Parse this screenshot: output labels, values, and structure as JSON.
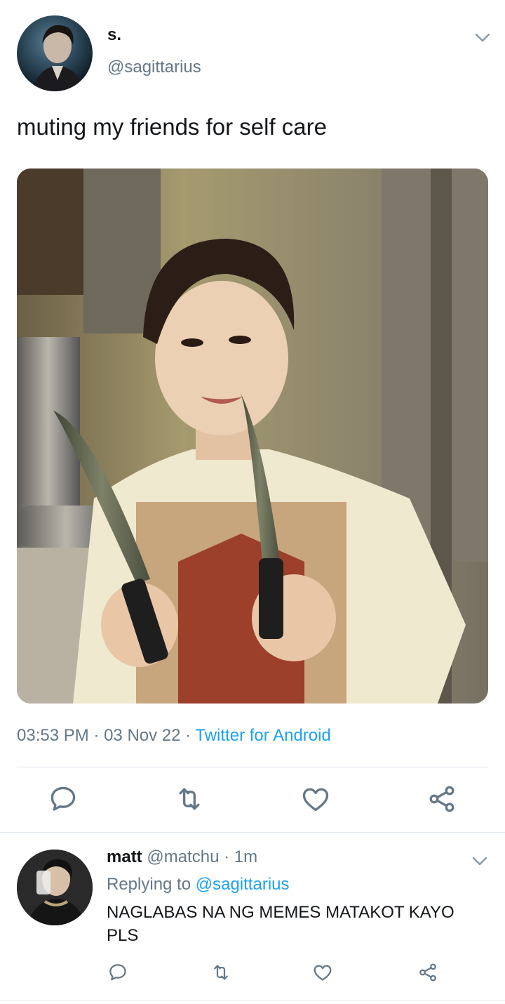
{
  "tweet": {
    "author": {
      "display_name": "s.",
      "handle": "@sagittarius"
    },
    "text": "muting my friends for self care",
    "meta": {
      "time": "03:53 PM",
      "sep1": "·",
      "date": "03 Nov 22",
      "sep2": "·",
      "source": "Twitter for Android"
    },
    "actions": [
      "reply-icon",
      "retweet-icon",
      "like-icon",
      "share-icon"
    ]
  },
  "reply": {
    "author": {
      "display_name": "matt",
      "handle": "@matchu",
      "sep": "·",
      "time": "1m"
    },
    "replying_prefix": "Replying to ",
    "replying_to": "@sagittarius",
    "text": "NAGLABAS NA NG MEMES MATAKOT KAYO PLS"
  },
  "colors": {
    "accent": "#1da1f2",
    "secondary_text": "#657786",
    "icon": "#657786",
    "divider": "#e1e8ed"
  }
}
